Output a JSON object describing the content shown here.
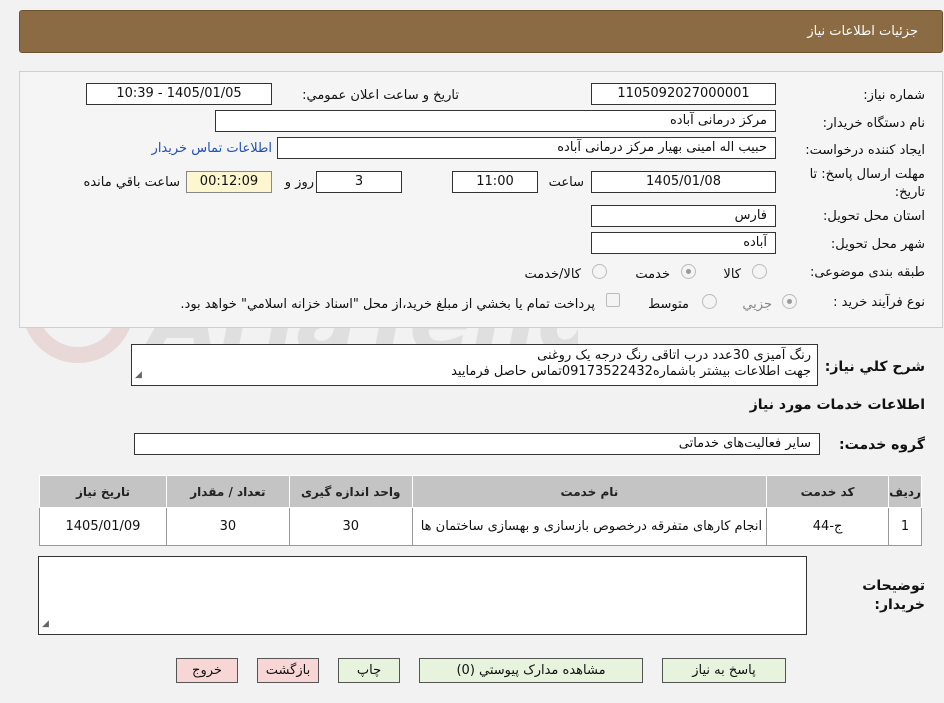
{
  "window": {
    "title": "جزئیات اطلاعات نیاز"
  },
  "watermark": {
    "text": "AriaTender.neT"
  },
  "fields": {
    "need_number_label": "شماره نیاز:",
    "need_number": "1105092027000001",
    "announce_label": "تاريخ و ساعت اعلان عمومي:",
    "announce_value": "1405/01/05 - 10:39",
    "buyer_label": "نام دستگاه خريدار:",
    "buyer": "مرکز درمانی آباده",
    "creator_label": "ايجاد کننده درخواست:",
    "creator": "حبیب اله امینی بهیار مرکز درمانی آباده",
    "contact_link": "اطلاعات تماس خريدار",
    "deadline_label": "مهلت ارسال پاسخ: تا تاريخ:",
    "deadline_date": "1405/01/08",
    "time_label": "ساعت",
    "deadline_time": "11:00",
    "days": "3",
    "days_label": "روز و",
    "remaining": "00:12:09",
    "remaining_label": "ساعت باقي مانده",
    "province_label": "استان محل تحويل:",
    "province": "فارس",
    "city_label": "شهر محل تحويل:",
    "city": "آباده",
    "category_label": "طبقه بندی موضوعی:",
    "category_options": [
      "کالا",
      "خدمت",
      "کالا/خدمت"
    ],
    "category_selected": "خدمت",
    "process_label": "نوع فرآيند خريد :",
    "process_options": [
      "جزيي",
      "متوسط"
    ],
    "process_selected": "جزيي",
    "payment_note": "پرداخت تمام يا بخشي از مبلغ خريد،از محل \"اسناد خزانه اسلامي\" خواهد بود."
  },
  "description": {
    "label": "شرح كلي نياز:",
    "lines": [
      "رنگ آمیزی 30عدد درب اتاقی رنگ درجه یک روغنی",
      "جهت اطلاعات بیشتر باشماره09173522432تماس حاصل فرمایید"
    ]
  },
  "services": {
    "heading": "اطلاعات خدمات مورد نياز",
    "group_label": "گروه خدمت:",
    "group_value": "ساير فعاليت‌هاى خدماتى",
    "columns": [
      "رديف",
      "کد خدمت",
      "نام خدمت",
      "واحد اندازه گيری",
      "تعداد / مقدار",
      "تاريخ نياز"
    ],
    "rows": [
      [
        "1",
        "ج-44",
        "انجام کارهای متفرقه درخصوص بازسازی و بهسازی ساختمان ها",
        "30",
        "30",
        "1405/01/09"
      ]
    ]
  },
  "buyer_notes": {
    "label": "توضيحات خريدار:",
    "value": ""
  },
  "buttons": {
    "reply": "پاسخ به نیاز",
    "attachments": "مشاهده مدارک پيوستي (0)",
    "print": "چاپ",
    "back": "بازگشت",
    "exit": "خروج"
  }
}
